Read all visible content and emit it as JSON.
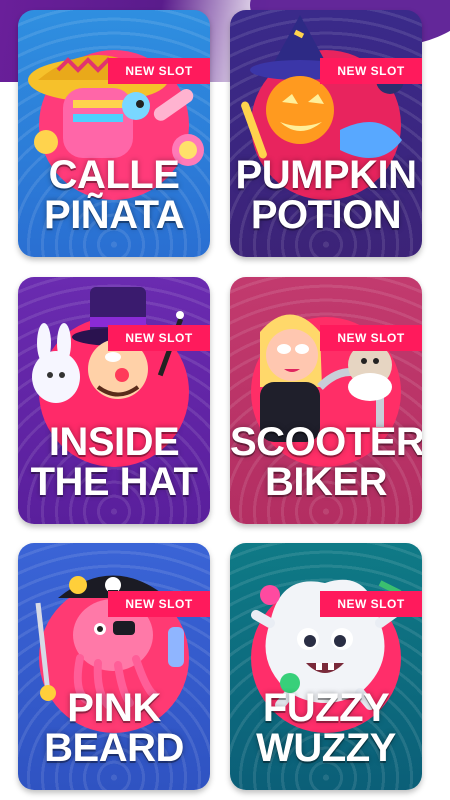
{
  "games": [
    {
      "title_line1": "CALLE",
      "title_line2": "PIÑATA",
      "badge": "NEW SLOT",
      "character_icon": "pinata-character-icon"
    },
    {
      "title_line1": "PUMPKIN",
      "title_line2": "POTION",
      "badge": "NEW SLOT",
      "character_icon": "pumpkin-witch-icon"
    },
    {
      "title_line1": "INSIDE",
      "title_line2": "THE HAT",
      "badge": "NEW SLOT",
      "character_icon": "magician-rabbit-icon"
    },
    {
      "title_line1": "SCOOTER",
      "title_line2": "BIKER",
      "badge": "NEW SLOT",
      "character_icon": "scooter-bikers-icon"
    },
    {
      "title_line1": "PINK",
      "title_line2": "BEARD",
      "badge": "NEW SLOT",
      "character_icon": "octopus-pirate-icon"
    },
    {
      "title_line1": "FUZZY",
      "title_line2": "WUZZY",
      "badge": "NEW SLOT",
      "character_icon": "fuzzy-monster-icon"
    }
  ],
  "colors": {
    "badge": "#ff1a5c",
    "header_purple": "#5b1b93",
    "card_calle_pinata": "#2f8fe0",
    "card_pumpkin_potion": "#3a2a8a",
    "card_inside_the_hat": "#6a2bb0",
    "card_scooter_biker": "#c23a6e",
    "card_pink_beard": "#3a64d6",
    "card_fuzzy_wuzzy": "#0f7a86"
  }
}
